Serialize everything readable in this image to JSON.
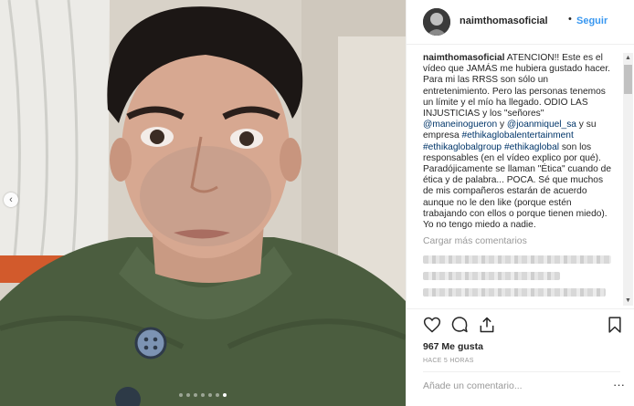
{
  "post": {
    "username": "naimthomasoficial",
    "bullet": "•",
    "follow_label": "Seguir",
    "caption": {
      "user": "naimthomasoficial",
      "text_1": " ATENCIÓN!! Este es el vídeo que JAMÁS me hubiera gustado hacer. Para mi las RRSS son sólo un entretenimiento. Pero las personas tenemos un límite y el mío ha llegado. ODIO LAS INJUSTICIAS y los \"señores\" ",
      "tag_1": "@maneinogueron",
      "text_2": " y ",
      "tag_2": "@joanmiquel_sa",
      "text_3": " y su empresa ",
      "tag_3": "#ethikaglobalentertainment",
      "text_4": " ",
      "tag_4": "#ethikaglobalgroup",
      "text_5": " ",
      "tag_5": "#ethikaglobal",
      "text_6": " son los responsables (en el vídeo explico por qué). Paradójicamente se llaman \"Ética\" cuando de ética y de palabra... POCA. Sé que muchos de mis compañeros estarán de acuerdo aunque no le den like (porque estén trabajando con ellos o porque tienen miedo). Yo no tengo miedo a nadie."
    },
    "load_more_label": "Cargar más comentarios",
    "likes": "967 Me gusta",
    "time": "HACE 5 HORAS",
    "comment_placeholder": "Añade un comentario...",
    "more_options": "···"
  },
  "icons": {
    "like": "heart-icon",
    "comment": "comment-icon",
    "share": "share-icon",
    "save": "bookmark-icon",
    "prev": "chevron-left-icon",
    "scroll_up": "triangle-up-icon",
    "scroll_down": "triangle-down-icon"
  },
  "carousel": {
    "slides": 7,
    "active_index": 6
  },
  "colors": {
    "link": "#003569",
    "follow": "#3897f0",
    "muted": "#999999"
  }
}
